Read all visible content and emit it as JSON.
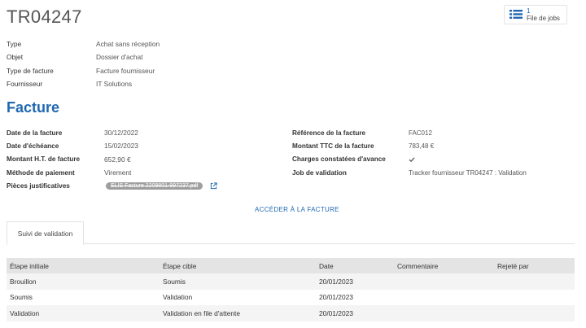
{
  "header": {
    "title": "TR04247",
    "jobs_count": "1",
    "jobs_label": "File de jobs"
  },
  "summary": [
    {
      "label": "Type",
      "value": "Achat sans réception"
    },
    {
      "label": "Objet",
      "value": "Dossier d'achat"
    },
    {
      "label": "Type de facture",
      "value": "Facture fournisseur"
    },
    {
      "label": "Fournisseur",
      "value": "IT Solutions"
    }
  ],
  "invoice": {
    "section_title": "Facture",
    "left": [
      {
        "label": "Date de la facture",
        "value": "30/12/2022"
      },
      {
        "label": "Date d'échéance",
        "value": "15/02/2023"
      },
      {
        "label": "Montant H.T. de facture",
        "value": "652,90 €"
      },
      {
        "label": "Méthode de paiement",
        "value": "Virement"
      },
      {
        "label": "Pièces justificatives",
        "value": "ELIS Facture 2209801-997237.pdf"
      }
    ],
    "right": [
      {
        "label": "Référence de la facture",
        "value": "FAC012"
      },
      {
        "label": "Montant TTC de la facture",
        "value": "783,48 €"
      },
      {
        "label": "Charges constatées d'avance",
        "value": ""
      },
      {
        "label": "Job de validation",
        "value": "Tracker fournisseur TR04247 : Validation"
      }
    ],
    "access_link": "ACCÉDER À LA FACTURE"
  },
  "tabs": [
    {
      "label": "Suivi de validation",
      "active": true
    }
  ],
  "validation_table": {
    "columns": [
      "Étape initiale",
      "Étape cible",
      "Date",
      "Commentaire",
      "Rejeté par"
    ],
    "rows": [
      [
        "Brouillon",
        "Soumis",
        "20/01/2023",
        "",
        ""
      ],
      [
        "Soumis",
        "Validation",
        "20/01/2023",
        "",
        ""
      ],
      [
        "Validation",
        "Validation en file d'attente",
        "20/01/2023",
        "",
        ""
      ]
    ]
  },
  "icons": {
    "jobs": "list-icon",
    "charges": "check-icon",
    "attachment": "external-link-icon"
  },
  "colors": {
    "accent": "#1f67b1",
    "header_bg": "#e4e4e4",
    "chip_bg": "#9e9e9e"
  }
}
